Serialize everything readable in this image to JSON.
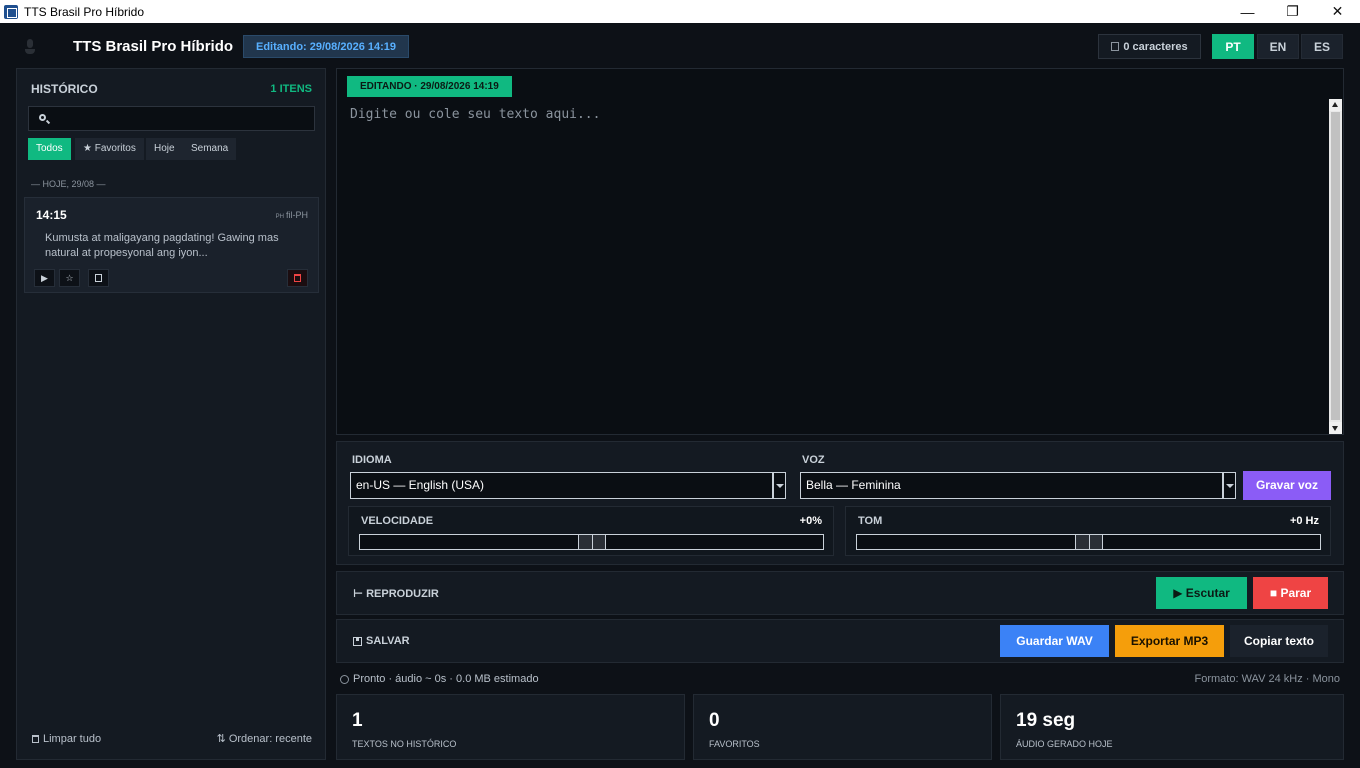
{
  "window": {
    "title": "TTS Brasil Pro Híbrido",
    "controls": {
      "minimize": "—",
      "maximize": "❐",
      "close": "✕"
    }
  },
  "header": {
    "app_title": "TTS Brasil Pro Híbrido",
    "editing_badge": "Editando: 29/08/2026 14:19",
    "char_count": "0 caracteres",
    "languages": [
      "PT",
      "EN",
      "ES"
    ],
    "active_language": "PT"
  },
  "sidebar": {
    "title": "HISTÓRICO",
    "count": "1 ITENS",
    "search_placeholder": "",
    "filters": [
      "Todos",
      "★ Favoritos",
      "Hoje",
      "Semana"
    ],
    "active_filter": "Todos",
    "day_separator": "— HOJE, 29/08 —",
    "items": [
      {
        "time": "14:15",
        "flag": "PH",
        "lang": "fil-PH",
        "text": "Kumusta at maligayang pagdating! Gawing mas natural at propesyonal ang iyon...",
        "play": "▶",
        "star": "☆"
      }
    ],
    "footer_clear": "Limpar tudo",
    "footer_sort": "⇅ Ordenar: recente"
  },
  "editor": {
    "badge": "EDITANDO · 29/08/2026 14:19",
    "placeholder": "Digite ou cole seu texto aqui..."
  },
  "settings": {
    "language_label": "IDIOMA",
    "language_value": "en-US — English (USA)",
    "voice_label": "VOZ",
    "voice_value": "Bella — Feminina",
    "record_button": "Gravar voz",
    "speed_label": "VELOCIDADE",
    "speed_value": "+0%",
    "speed_level": 0.5,
    "pitch_label": "TOM",
    "pitch_value": "+0 Hz",
    "pitch_level": 0.5
  },
  "playback": {
    "label": "⊢ REPRODUZIR",
    "listen_button": "▶ Escutar",
    "stop_button": "■ Parar"
  },
  "save": {
    "label": "SALVAR",
    "wav_button": "Guardar WAV",
    "mp3_button": "Exportar MP3",
    "copy_button": "Copiar texto"
  },
  "status": {
    "left": "Pronto · áudio ~ 0s · 0.0 MB estimado",
    "right": "Formato: WAV 24 kHz · Mono"
  },
  "stats": [
    {
      "value": "1",
      "label": "TEXTOS NO HISTÓRICO"
    },
    {
      "value": "0",
      "label": "FAVORITOS"
    },
    {
      "value": "19 seg",
      "label": "ÁUDIO GERADO HOJE"
    }
  ],
  "colors": {
    "accent_green": "#10b981",
    "accent_blue": "#3b82f6",
    "accent_amber": "#f59e0b",
    "accent_red": "#ef4444",
    "accent_purple": "#8b5cf6",
    "background": "#0d1117"
  }
}
